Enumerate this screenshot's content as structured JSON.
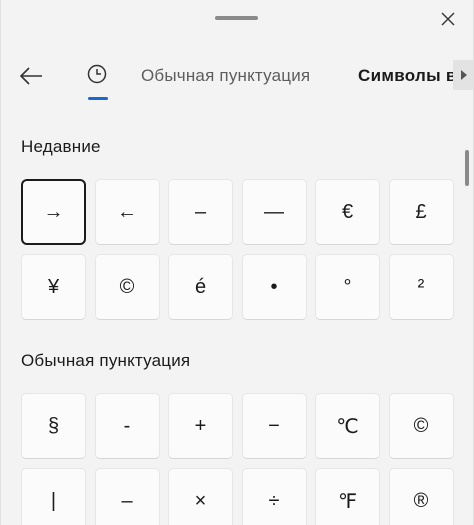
{
  "nav": {
    "tabs": [
      {
        "icon": "clock-icon",
        "active": true
      },
      {
        "label": "Обычная пунктуация"
      },
      {
        "label": "Символы валюты"
      }
    ]
  },
  "sections": [
    {
      "title": "Недавние",
      "symbols": [
        "→",
        "←",
        "–",
        "—",
        "€",
        "£",
        "¥",
        "©",
        "é",
        "•",
        "°",
        "²"
      ]
    },
    {
      "title": "Обычная пунктуация",
      "symbols": [
        "§",
        "-",
        "+",
        "−",
        "℃",
        "©",
        "|",
        "–",
        "×",
        "÷",
        "℉",
        "®"
      ]
    }
  ],
  "colors": {
    "accent": "#1967d2",
    "background": "#f3f3f3",
    "key": "#fbfbfb"
  }
}
